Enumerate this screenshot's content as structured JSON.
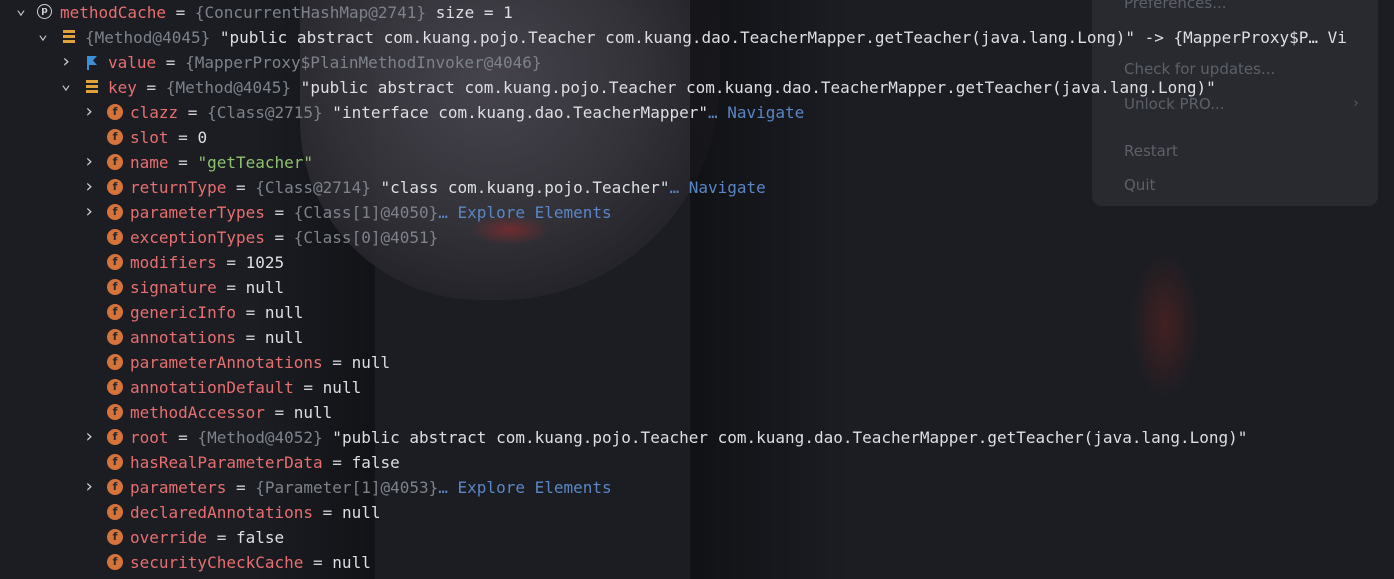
{
  "menu": {
    "items": [
      "Preferences...",
      "Check for updates...",
      "Unlock PRO...",
      "Restart",
      "Quit"
    ]
  },
  "rows": [
    {
      "indent": 0,
      "chev": "down",
      "icon": "map",
      "name": "methodCache",
      "ref": "{ConcurrentHashMap@2741}",
      "value": " size = 1",
      "vclass": "str"
    },
    {
      "indent": 1,
      "chev": "down",
      "icon": "stack",
      "name": "",
      "ref": "{Method@4045}",
      "value": "\"public abstract com.kuang.pojo.Teacher com.kuang.dao.TeacherMapper.getTeacher(java.lang.Long)\" -> {MapperProxy$P… Vi",
      "vclass": "str",
      "noeq": true
    },
    {
      "indent": 2,
      "chev": "right",
      "icon": "flag",
      "name": "value",
      "ref": "{MapperProxy$PlainMethodInvoker@4046}",
      "value": "",
      "vclass": "str"
    },
    {
      "indent": 2,
      "chev": "down",
      "icon": "stack",
      "name": "key",
      "ref": "{Method@4045}",
      "value": "\"public abstract com.kuang.pojo.Teacher com.kuang.dao.TeacherMapper.getTeacher(java.lang.Long)\"",
      "vclass": "str"
    },
    {
      "indent": 3,
      "chev": "right",
      "icon": "f",
      "name": "clazz",
      "ref": "{Class@2715}",
      "value": "\"interface com.kuang.dao.TeacherMapper\"",
      "vclass": "str",
      "link": "… Navigate"
    },
    {
      "indent": 3,
      "chev": "",
      "icon": "f",
      "name": "slot",
      "ref": "",
      "value": "0",
      "vclass": "num"
    },
    {
      "indent": 3,
      "chev": "right",
      "icon": "f",
      "name": "name",
      "ref": "",
      "value": "\"getTeacher\"",
      "vclass": "green"
    },
    {
      "indent": 3,
      "chev": "right",
      "icon": "f",
      "name": "returnType",
      "ref": "{Class@2714}",
      "value": "\"class com.kuang.pojo.Teacher\"",
      "vclass": "str",
      "link": "… Navigate"
    },
    {
      "indent": 3,
      "chev": "right",
      "icon": "f",
      "name": "parameterTypes",
      "ref": "{Class[1]@4050}",
      "value": "",
      "vclass": "str",
      "link": "… Explore Elements"
    },
    {
      "indent": 3,
      "chev": "",
      "icon": "f",
      "name": "exceptionTypes",
      "ref": "{Class[0]@4051}",
      "value": "",
      "vclass": "str"
    },
    {
      "indent": 3,
      "chev": "",
      "icon": "f",
      "name": "modifiers",
      "ref": "",
      "value": "1025",
      "vclass": "num"
    },
    {
      "indent": 3,
      "chev": "",
      "icon": "f",
      "name": "signature",
      "ref": "",
      "value": "null",
      "vclass": "null"
    },
    {
      "indent": 3,
      "chev": "",
      "icon": "f",
      "name": "genericInfo",
      "ref": "",
      "value": "null",
      "vclass": "null"
    },
    {
      "indent": 3,
      "chev": "",
      "icon": "f",
      "name": "annotations",
      "ref": "",
      "value": "null",
      "vclass": "null"
    },
    {
      "indent": 3,
      "chev": "",
      "icon": "f",
      "name": "parameterAnnotations",
      "ref": "",
      "value": "null",
      "vclass": "null"
    },
    {
      "indent": 3,
      "chev": "",
      "icon": "f",
      "name": "annotationDefault",
      "ref": "",
      "value": "null",
      "vclass": "null"
    },
    {
      "indent": 3,
      "chev": "",
      "icon": "f",
      "name": "methodAccessor",
      "ref": "",
      "value": "null",
      "vclass": "null"
    },
    {
      "indent": 3,
      "chev": "right",
      "icon": "f",
      "name": "root",
      "ref": "{Method@4052}",
      "value": "\"public abstract com.kuang.pojo.Teacher com.kuang.dao.TeacherMapper.getTeacher(java.lang.Long)\"",
      "vclass": "str"
    },
    {
      "indent": 3,
      "chev": "",
      "icon": "f",
      "name": "hasRealParameterData",
      "ref": "",
      "value": "false",
      "vclass": "null"
    },
    {
      "indent": 3,
      "chev": "right",
      "icon": "f",
      "name": "parameters",
      "ref": "{Parameter[1]@4053}",
      "value": "",
      "vclass": "str",
      "link": "… Explore Elements"
    },
    {
      "indent": 3,
      "chev": "",
      "icon": "f",
      "name": "declaredAnnotations",
      "ref": "",
      "value": "null",
      "vclass": "null"
    },
    {
      "indent": 3,
      "chev": "",
      "icon": "f",
      "name": "override",
      "ref": "",
      "value": "false",
      "vclass": "null"
    },
    {
      "indent": 3,
      "chev": "",
      "icon": "f",
      "name": "securityCheckCache",
      "ref": "",
      "value": "null",
      "vclass": "null"
    }
  ]
}
